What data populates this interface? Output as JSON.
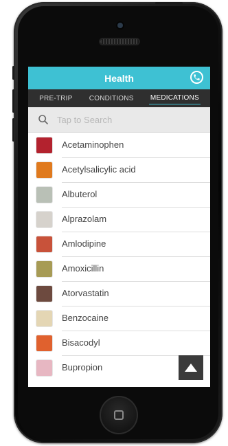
{
  "header": {
    "title": "Health",
    "phone_icon": "phone-icon"
  },
  "tabs": [
    {
      "label": "PRE-TRIP",
      "active": false
    },
    {
      "label": "CONDITIONS",
      "active": false
    },
    {
      "label": "MEDICATIONS",
      "active": true
    }
  ],
  "search": {
    "placeholder": "Tap to Search",
    "value": "",
    "icon": "search-icon"
  },
  "medications": [
    {
      "name": "Acetaminophen",
      "thumb_color": "#b3222e"
    },
    {
      "name": "Acetylsalicylic acid",
      "thumb_color": "#e07a1e"
    },
    {
      "name": "Albuterol",
      "thumb_color": "#b9c0b6"
    },
    {
      "name": "Alprazolam",
      "thumb_color": "#d6d2cc"
    },
    {
      "name": "Amlodipine",
      "thumb_color": "#c8523a"
    },
    {
      "name": "Amoxicillin",
      "thumb_color": "#a79b55"
    },
    {
      "name": "Atorvastatin",
      "thumb_color": "#6d4a3f"
    },
    {
      "name": "Benzocaine",
      "thumb_color": "#e4d6b4"
    },
    {
      "name": "Bisacodyl",
      "thumb_color": "#e0612e"
    },
    {
      "name": "Bupropion",
      "thumb_color": "#e7b7c2"
    }
  ],
  "colors": {
    "accent": "#3ec1d3",
    "tab_bar": "#2f2f2f",
    "search_bg": "#e9e9e9"
  }
}
